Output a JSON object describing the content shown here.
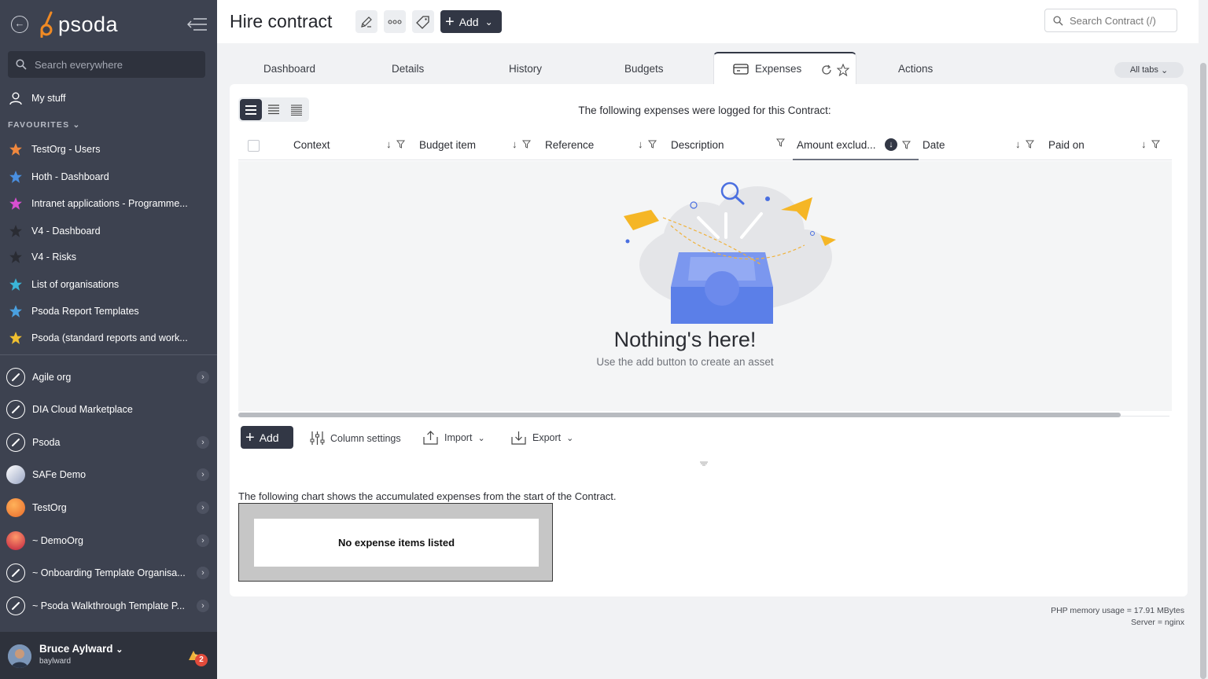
{
  "sidebar": {
    "logo_text": "psoda",
    "search_placeholder": "Search everywhere",
    "my_stuff": "My stuff",
    "favourites_heading": "FAVOURITES",
    "favourites": [
      {
        "label": "TestOrg - Users",
        "color": "#f0883e"
      },
      {
        "label": "Hoth - Dashboard",
        "color": "#4a8fe0"
      },
      {
        "label": "Intranet applications - Programme...",
        "color": "#d84fd0"
      },
      {
        "label": "V4 - Dashboard",
        "color": "#2a2c33"
      },
      {
        "label": "V4 - Risks",
        "color": "#2a2c33"
      },
      {
        "label": "List of organisations",
        "color": "#3ab5d8"
      },
      {
        "label": "Psoda Report Templates",
        "color": "#4aa0e0"
      },
      {
        "label": "Psoda (standard reports and work...",
        "color": "#f0c030"
      }
    ],
    "orgs": [
      {
        "label": "Agile org",
        "chevron": true
      },
      {
        "label": "DIA Cloud Marketplace",
        "chevron": false
      },
      {
        "label": "Psoda",
        "chevron": true
      },
      {
        "label": "SAFe Demo",
        "chevron": true
      },
      {
        "label": "TestOrg",
        "chevron": true
      },
      {
        "label": "~ DemoOrg",
        "chevron": true
      },
      {
        "label": "~ Onboarding Template Organisa...",
        "chevron": true
      },
      {
        "label": "~ Psoda Walkthrough Template P...",
        "chevron": true
      }
    ],
    "user": {
      "name": "Bruce Aylward",
      "login": "baylward",
      "notifications": "2"
    }
  },
  "header": {
    "title": "Hire contract",
    "add_label": "Add",
    "search_placeholder": "Search Contract (/)"
  },
  "tabs": {
    "items": [
      "Dashboard",
      "Details",
      "History",
      "Budgets",
      "Expenses",
      "Actions"
    ],
    "active": "Expenses",
    "all_tabs": "All tabs"
  },
  "content": {
    "intro": "The following expenses were logged for this Contract:",
    "columns": [
      "Context",
      "Budget item",
      "Reference",
      "Description",
      "Amount exclud...",
      "Date",
      "Paid on"
    ],
    "empty_title": "Nothing's here!",
    "empty_sub": "Use the add button to create an asset",
    "toolbar": {
      "add": "Add",
      "column_settings": "Column settings",
      "import": "Import",
      "export": "Export"
    },
    "chart_intro": "The following chart shows the accumulated expenses from the start of the Contract.",
    "chart_empty": "No expense items listed"
  },
  "footer": {
    "memory": "PHP memory usage = 17.91 MBytes",
    "server": "Server = nginx"
  },
  "colors": {
    "accent": "#323745",
    "sidebar": "#3d4250",
    "brand": "#f08a24"
  }
}
